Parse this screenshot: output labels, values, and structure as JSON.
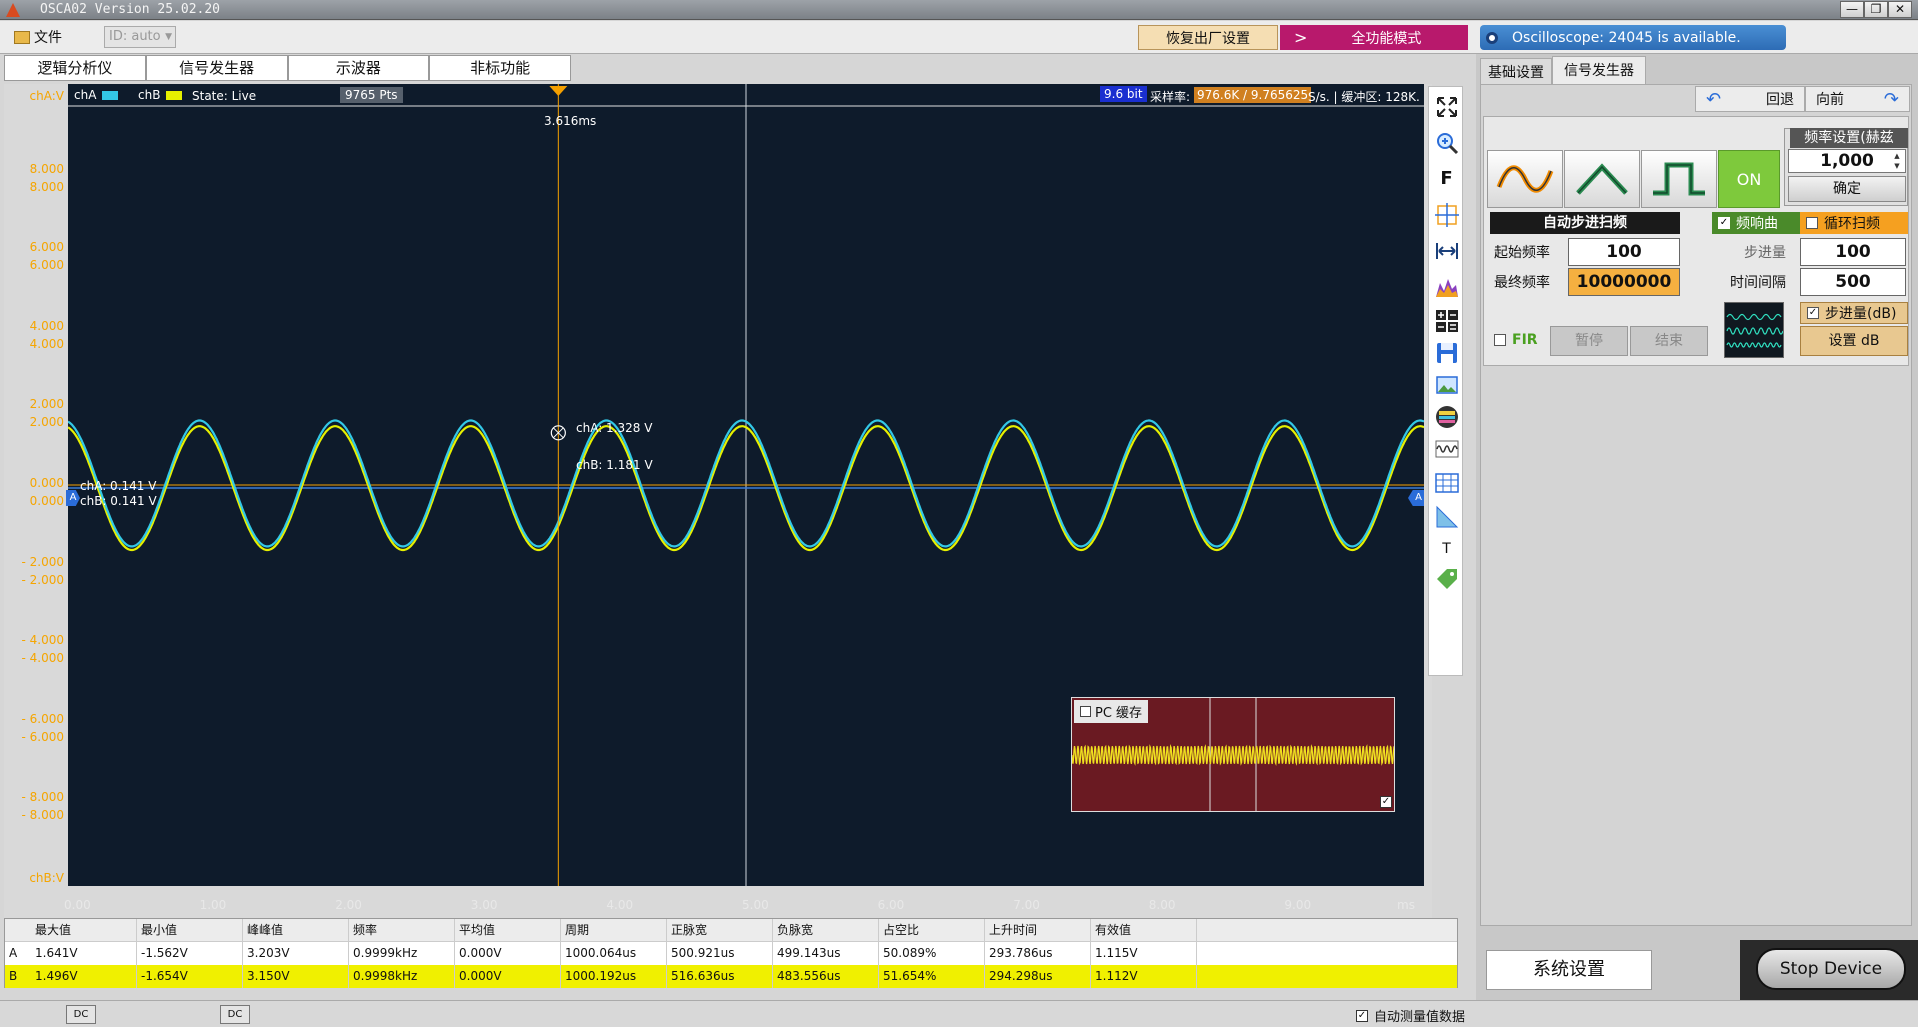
{
  "window": {
    "title": "OSCA02  Version 25.02.20",
    "min": "—",
    "max": "❐",
    "close": "✕"
  },
  "menu": {
    "file": "文件",
    "id_value": "ID: auto",
    "restore_factory": "恢复出厂设置",
    "full_mode_arrow": ">",
    "full_mode": "全功能模式",
    "status_msg": "Oscilloscope: 24045 is available."
  },
  "mode_tabs": [
    "逻辑分析仪",
    "信号发生器",
    "示波器",
    "非标功能"
  ],
  "scope": {
    "cha_axis_label": "chA:V",
    "chb_axis_label": "chB:V",
    "legend_a": "chA",
    "legend_b": "chB",
    "state": "State: Live",
    "pts": "9765 Pts",
    "bits": "9.6 bit",
    "rate_label": "采样率:",
    "rate_value": "976.6K / 9.765625",
    "rate_unit": "S/s. | 缓冲区:  128K.",
    "cursor_time": "3.616ms",
    "cursor_a": "chA: 1.328 V",
    "cursor_b": "chB: 1.181 V",
    "offset_a": "chA: 0.141 V",
    "offset_b": "chB: 0.141 V",
    "marker": "A",
    "pc_cache": "PC 缓存",
    "colors": {
      "bg": "#0e1b2b",
      "cha": "#33c8e6",
      "chb": "#e6f000",
      "cursor": "#f5a000"
    }
  },
  "chart_data": {
    "type": "line",
    "x_unit": "ms",
    "xlim": [
      0,
      10
    ],
    "ylim": [
      -10,
      10
    ],
    "x_ticks": [
      "0.00",
      "1.00",
      "2.00",
      "3.00",
      "4.00",
      "5.00",
      "6.00",
      "7.00",
      "8.00",
      "9.00"
    ],
    "y_ticks_a": [
      "8.000",
      "6.000",
      "4.000",
      "2.000",
      "0.000",
      "- 2.000",
      "- 4.000",
      "- 6.000",
      "- 8.000"
    ],
    "y_ticks_b": [
      "8.000",
      "6.000",
      "4.000",
      "2.000",
      "0.000",
      "- 2.000",
      "- 4.000",
      "- 6.000",
      "- 8.000"
    ],
    "series": [
      {
        "name": "chA",
        "frequency_khz": 0.9999,
        "max": 1.641,
        "min": -1.562,
        "color": "#33c8e6"
      },
      {
        "name": "chB",
        "frequency_khz": 0.9998,
        "max": 1.496,
        "min": -1.654,
        "color": "#e6f000"
      }
    ]
  },
  "measure": {
    "headers": [
      "",
      "最大值",
      "最小值",
      "峰峰值",
      "频率",
      "平均值",
      "周期",
      "正脉宽",
      "负脉宽",
      "占空比",
      "上升时间",
      "有效值"
    ],
    "rows": [
      [
        "A",
        "1.641V",
        "-1.562V",
        "3.203V",
        "0.9999kHz",
        "0.000V",
        "1000.064us",
        "500.921us",
        "499.143us",
        "50.089%",
        "293.786us",
        "1.115V"
      ],
      [
        "B",
        "1.496V",
        "-1.654V",
        "3.150V",
        "0.9998kHz",
        "0.000V",
        "1000.192us",
        "516.636us",
        "483.556us",
        "51.654%",
        "294.298us",
        "1.112V"
      ]
    ]
  },
  "status": {
    "dc1": "DC",
    "dc2": "DC",
    "auto_measure": "自动测量值数据"
  },
  "right": {
    "tabs": [
      "基础设置",
      "信号发生器"
    ],
    "back": "回退",
    "forward": "向前",
    "freq_title": "频率设置(赫兹",
    "freq_value": "1,000",
    "confirm": "确定",
    "on": "ON",
    "sweep_title": "自动步进扫频",
    "freq_resp": "频响曲",
    "loop_sweep": "循环扫频",
    "start_label": "起始频率",
    "start_value": "100",
    "end_label": "最终频率",
    "end_value": "10000000",
    "step_label": "步进量",
    "step_value": "100",
    "interval_label": "时间间隔",
    "interval_value": "500",
    "step_db": "步进量(dB)",
    "set_db": "设置 dB",
    "fir": "FIR",
    "pause": "暂停",
    "end": "结束",
    "sys_settings": "系统设置",
    "stop_device": "Stop Device"
  }
}
